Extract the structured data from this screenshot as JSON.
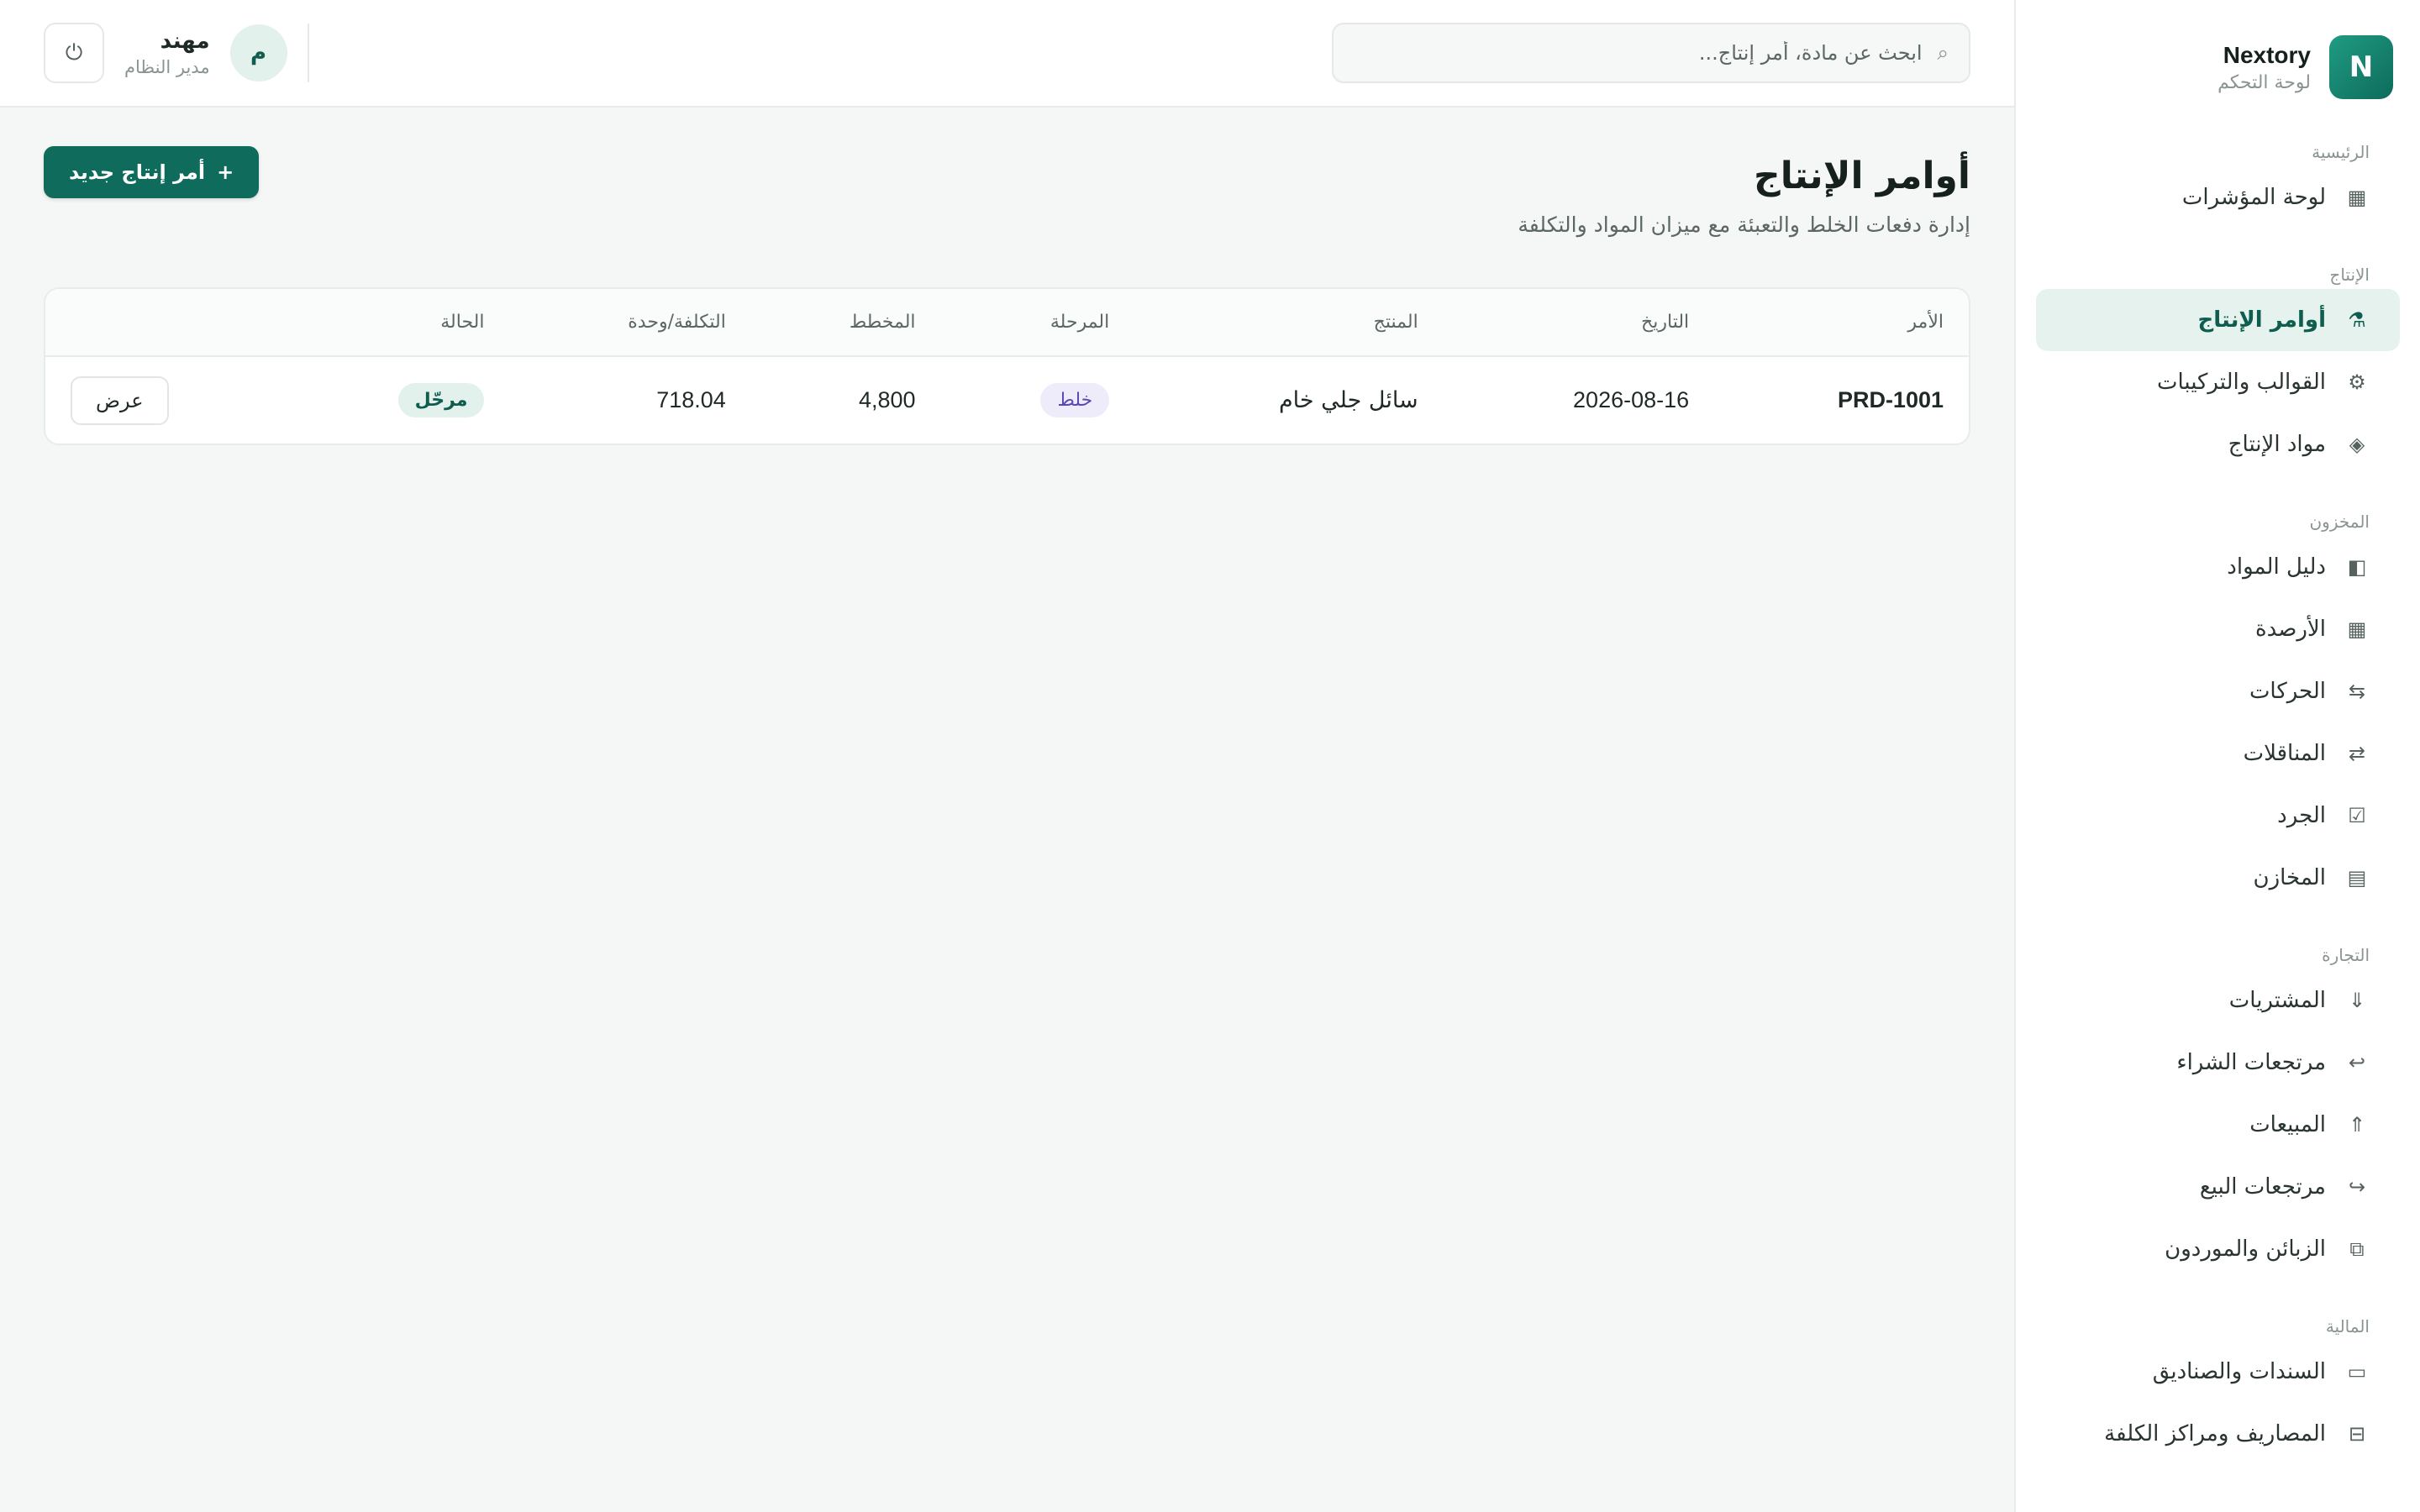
{
  "brand": {
    "logo_letter": "N",
    "name": "Nextory",
    "subtitle": "لوحة التحكم"
  },
  "sidebar": {
    "sections": [
      {
        "heading": "الرئيسية",
        "items": [
          {
            "label": "لوحة المؤشرات",
            "icon": "dashboard-grid-icon",
            "glyph": "▦",
            "active": false
          }
        ]
      },
      {
        "heading": "الإنتاج",
        "items": [
          {
            "label": "أوامر الإنتاج",
            "icon": "production-icon",
            "glyph": "⚗",
            "active": true
          },
          {
            "label": "القوالب والتركيبات",
            "icon": "gear-icon",
            "glyph": "⚙",
            "active": false
          },
          {
            "label": "مواد الإنتاج",
            "icon": "diamond-icon",
            "glyph": "◈",
            "active": false
          }
        ]
      },
      {
        "heading": "المخزون",
        "items": [
          {
            "label": "دليل المواد",
            "icon": "catalog-icon",
            "glyph": "◧",
            "active": false
          },
          {
            "label": "الأرصدة",
            "icon": "balances-grid-icon",
            "glyph": "▦",
            "active": false
          },
          {
            "label": "الحركات",
            "icon": "movements-icon",
            "glyph": "⇆",
            "active": false
          },
          {
            "label": "المناقلات",
            "icon": "transfer-icon",
            "glyph": "⇄",
            "active": false
          },
          {
            "label": "الجرد",
            "icon": "checkbox-icon",
            "glyph": "☑",
            "active": false
          },
          {
            "label": "المخازن",
            "icon": "warehouse-icon",
            "glyph": "▤",
            "active": false
          }
        ]
      },
      {
        "heading": "التجارة",
        "items": [
          {
            "label": "المشتريات",
            "icon": "arrow-down-icon",
            "glyph": "⇓",
            "active": false
          },
          {
            "label": "مرتجعات الشراء",
            "icon": "return-left-icon",
            "glyph": "↩",
            "active": false
          },
          {
            "label": "المبيعات",
            "icon": "arrow-up-icon",
            "glyph": "⇑",
            "active": false
          },
          {
            "label": "مرتجعات البيع",
            "icon": "return-right-icon",
            "glyph": "↪",
            "active": false
          },
          {
            "label": "الزبائن والموردون",
            "icon": "contacts-icon",
            "glyph": "⧉",
            "active": false
          }
        ]
      },
      {
        "heading": "المالية",
        "items": [
          {
            "label": "السندات والصناديق",
            "icon": "cash-icon",
            "glyph": "▭",
            "active": false
          },
          {
            "label": "المصاريف ومراكز الكلفة",
            "icon": "expenses-icon",
            "glyph": "⊟",
            "active": false
          }
        ]
      }
    ]
  },
  "topbar": {
    "search_placeholder": "ابحث عن مادة، أمر إنتاج...",
    "search_icon": "⌕",
    "user": {
      "avatar_letter": "م",
      "name": "مهند",
      "role": "مدير النظام"
    },
    "power_icon": "⏻"
  },
  "page": {
    "title": "أوامر الإنتاج",
    "subtitle": "إدارة دفعات الخلط والتعبئة مع ميزان المواد والتكلفة",
    "new_button_label": "أمر إنتاج جديد",
    "new_button_icon": "+"
  },
  "table": {
    "columns": [
      "الأمر",
      "التاريخ",
      "المنتج",
      "المرحلة",
      "المخطط",
      "التكلفة/وحدة",
      "الحالة",
      ""
    ],
    "rows": [
      {
        "order": "PRD-1001",
        "date": "2026-08-16",
        "product": "سائل جلي خام",
        "stage": "خلط",
        "planned": "4,800",
        "unit_cost": "718.04",
        "status": "مرحّل",
        "action": "عرض"
      }
    ]
  }
}
